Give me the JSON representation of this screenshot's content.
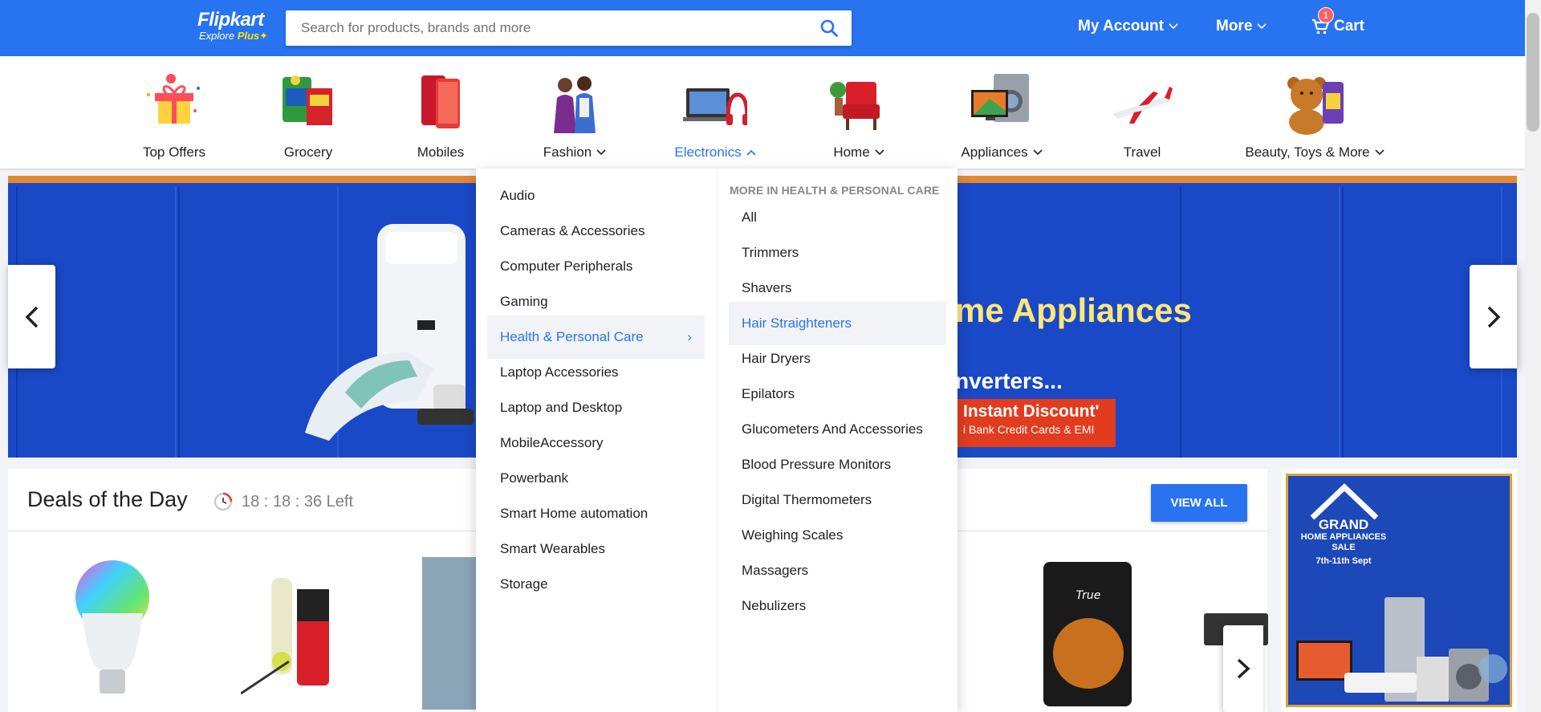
{
  "header": {
    "logo_brand": "Flipkart",
    "logo_sub": "Explore",
    "logo_plus": "Plus",
    "search_placeholder": "Search for products, brands and more",
    "account_label": "My Account",
    "more_label": "More",
    "cart_label": "Cart",
    "cart_count": "1"
  },
  "categories": [
    {
      "label": "Top Offers",
      "icon": "gift-icon"
    },
    {
      "label": "Grocery",
      "icon": "grocery-icon"
    },
    {
      "label": "Mobiles",
      "icon": "mobile-icon"
    },
    {
      "label": "Fashion",
      "icon": "fashion-icon"
    },
    {
      "label": "Electronics",
      "icon": "electronics-icon"
    },
    {
      "label": "Home",
      "icon": "home-icon"
    },
    {
      "label": "Appliances",
      "icon": "appliances-icon"
    },
    {
      "label": "Travel",
      "icon": "airplane-icon"
    },
    {
      "label": "Beauty, Toys & More",
      "icon": "teddy-icon"
    }
  ],
  "dropdown": {
    "items": [
      "Audio",
      "Cameras & Accessories",
      "Computer Peripherals",
      "Gaming",
      "Health & Personal Care",
      "Laptop Accessories",
      "Laptop and Desktop",
      "MobileAccessory",
      "Powerbank",
      "Smart Home automation",
      "Smart Wearables",
      "Storage"
    ],
    "sub_heading": "MORE IN HEALTH & PERSONAL CARE",
    "sub_items": [
      "All",
      "Trimmers",
      "Shavers",
      "Hair Straighteners",
      "Hair Dryers",
      "Epilators",
      "Glucometers And Accessories",
      "Blood Pressure Monitors",
      "Digital Thermometers",
      "Weighing Scales",
      "Massagers",
      "Nebulizers"
    ]
  },
  "banner": {
    "headline": "me Appliances",
    "subline": "nverters...",
    "badge": "Instant Discount",
    "badge_sub": "i Bank Credit Cards & EMI"
  },
  "deals": {
    "title": "Deals of the Day",
    "timer": "18 : 18 : 36 Left",
    "view_all": "VIEW ALL"
  },
  "promo": {
    "title": "GRAND",
    "sub": "HOME APPLIANCES SALE",
    "date": "7th-11th Sept"
  },
  "colors": {
    "brand_blue": "#2874f0",
    "accent_yellow": "#ffe500",
    "badge_red": "#ff6161"
  }
}
